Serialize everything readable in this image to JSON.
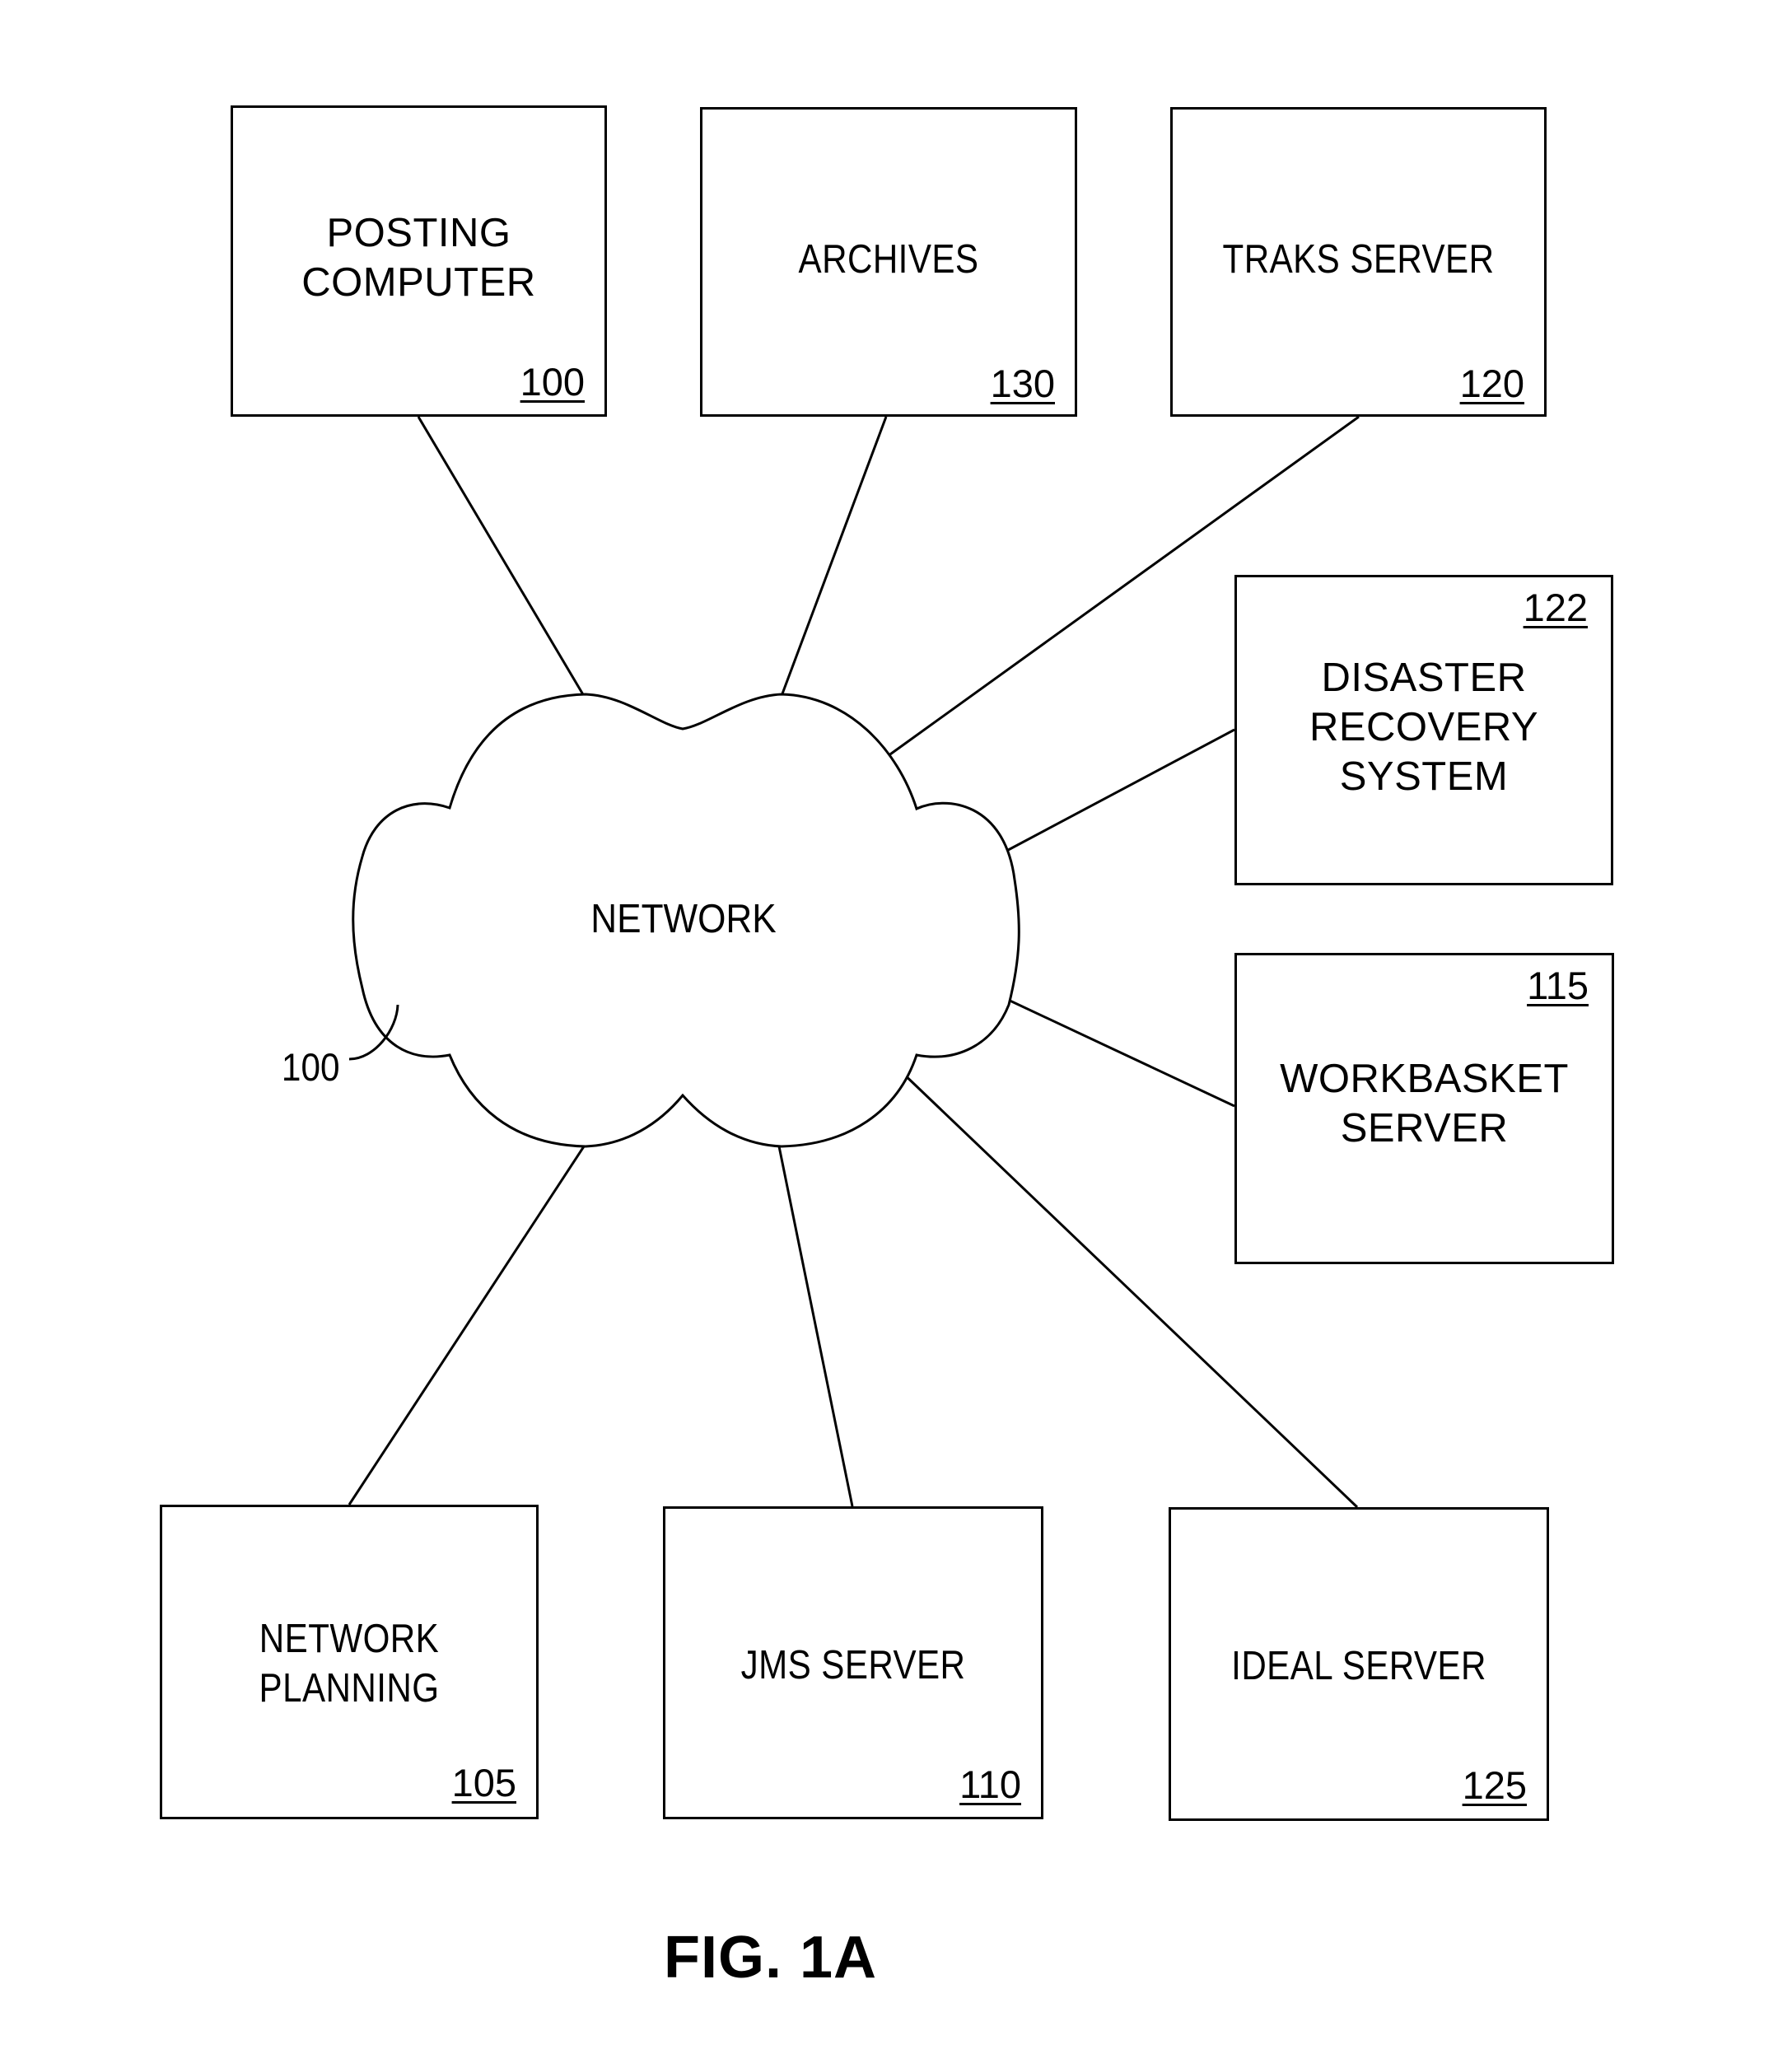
{
  "figure": {
    "caption": "FIG. 1A"
  },
  "network": {
    "label": "NETWORK",
    "ref": "100"
  },
  "nodes": {
    "posting_computer": {
      "line1": "POSTING",
      "line2": "COMPUTER",
      "ref": "100"
    },
    "archives": {
      "line1": "ARCHIVES",
      "ref": "130"
    },
    "traks_server": {
      "line1": "TRAKS SERVER",
      "ref": "120"
    },
    "disaster_recovery": {
      "line1": "DISASTER",
      "line2": "RECOVERY",
      "line3": "SYSTEM",
      "ref": "122"
    },
    "workbasket_server": {
      "line1": "WORKBASKET",
      "line2": "SERVER",
      "ref": "115"
    },
    "network_planning": {
      "line1": "NETWORK",
      "line2": "PLANNING",
      "ref": "105"
    },
    "jms_server": {
      "line1": "JMS SERVER",
      "ref": "110"
    },
    "ideal_server": {
      "line1": "IDEAL SERVER",
      "ref": "125"
    }
  },
  "connections": [
    [
      "network",
      "posting_computer"
    ],
    [
      "network",
      "archives"
    ],
    [
      "network",
      "traks_server"
    ],
    [
      "network",
      "disaster_recovery"
    ],
    [
      "network",
      "workbasket_server"
    ],
    [
      "network",
      "network_planning"
    ],
    [
      "network",
      "jms_server"
    ],
    [
      "network",
      "ideal_server"
    ]
  ]
}
